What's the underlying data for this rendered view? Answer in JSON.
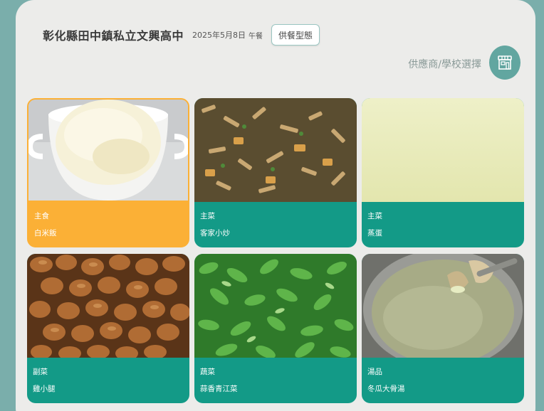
{
  "header": {
    "school_name": "彰化縣田中鎮私立文興高中",
    "date": "2025年5月8日",
    "meal": "午餐",
    "type_button": "供餐型態"
  },
  "supplier_link": "供應商/學校選擇",
  "store_icon": "store-icon",
  "colors": {
    "accent_teal": "#139a87",
    "selected_orange": "#fbb036",
    "background": "#7aaeab"
  },
  "cards": [
    {
      "category": "主食",
      "dish": "白米飯",
      "selected": true
    },
    {
      "category": "主菜",
      "dish": "客家小炒",
      "selected": false
    },
    {
      "category": "主菜",
      "dish": "蒸蛋",
      "selected": false
    },
    {
      "category": "副菜",
      "dish": "雞小腿",
      "selected": false
    },
    {
      "category": "蔬菜",
      "dish": "蒜香青江菜",
      "selected": false
    },
    {
      "category": "湯品",
      "dish": "冬瓜大骨湯",
      "selected": false
    }
  ]
}
